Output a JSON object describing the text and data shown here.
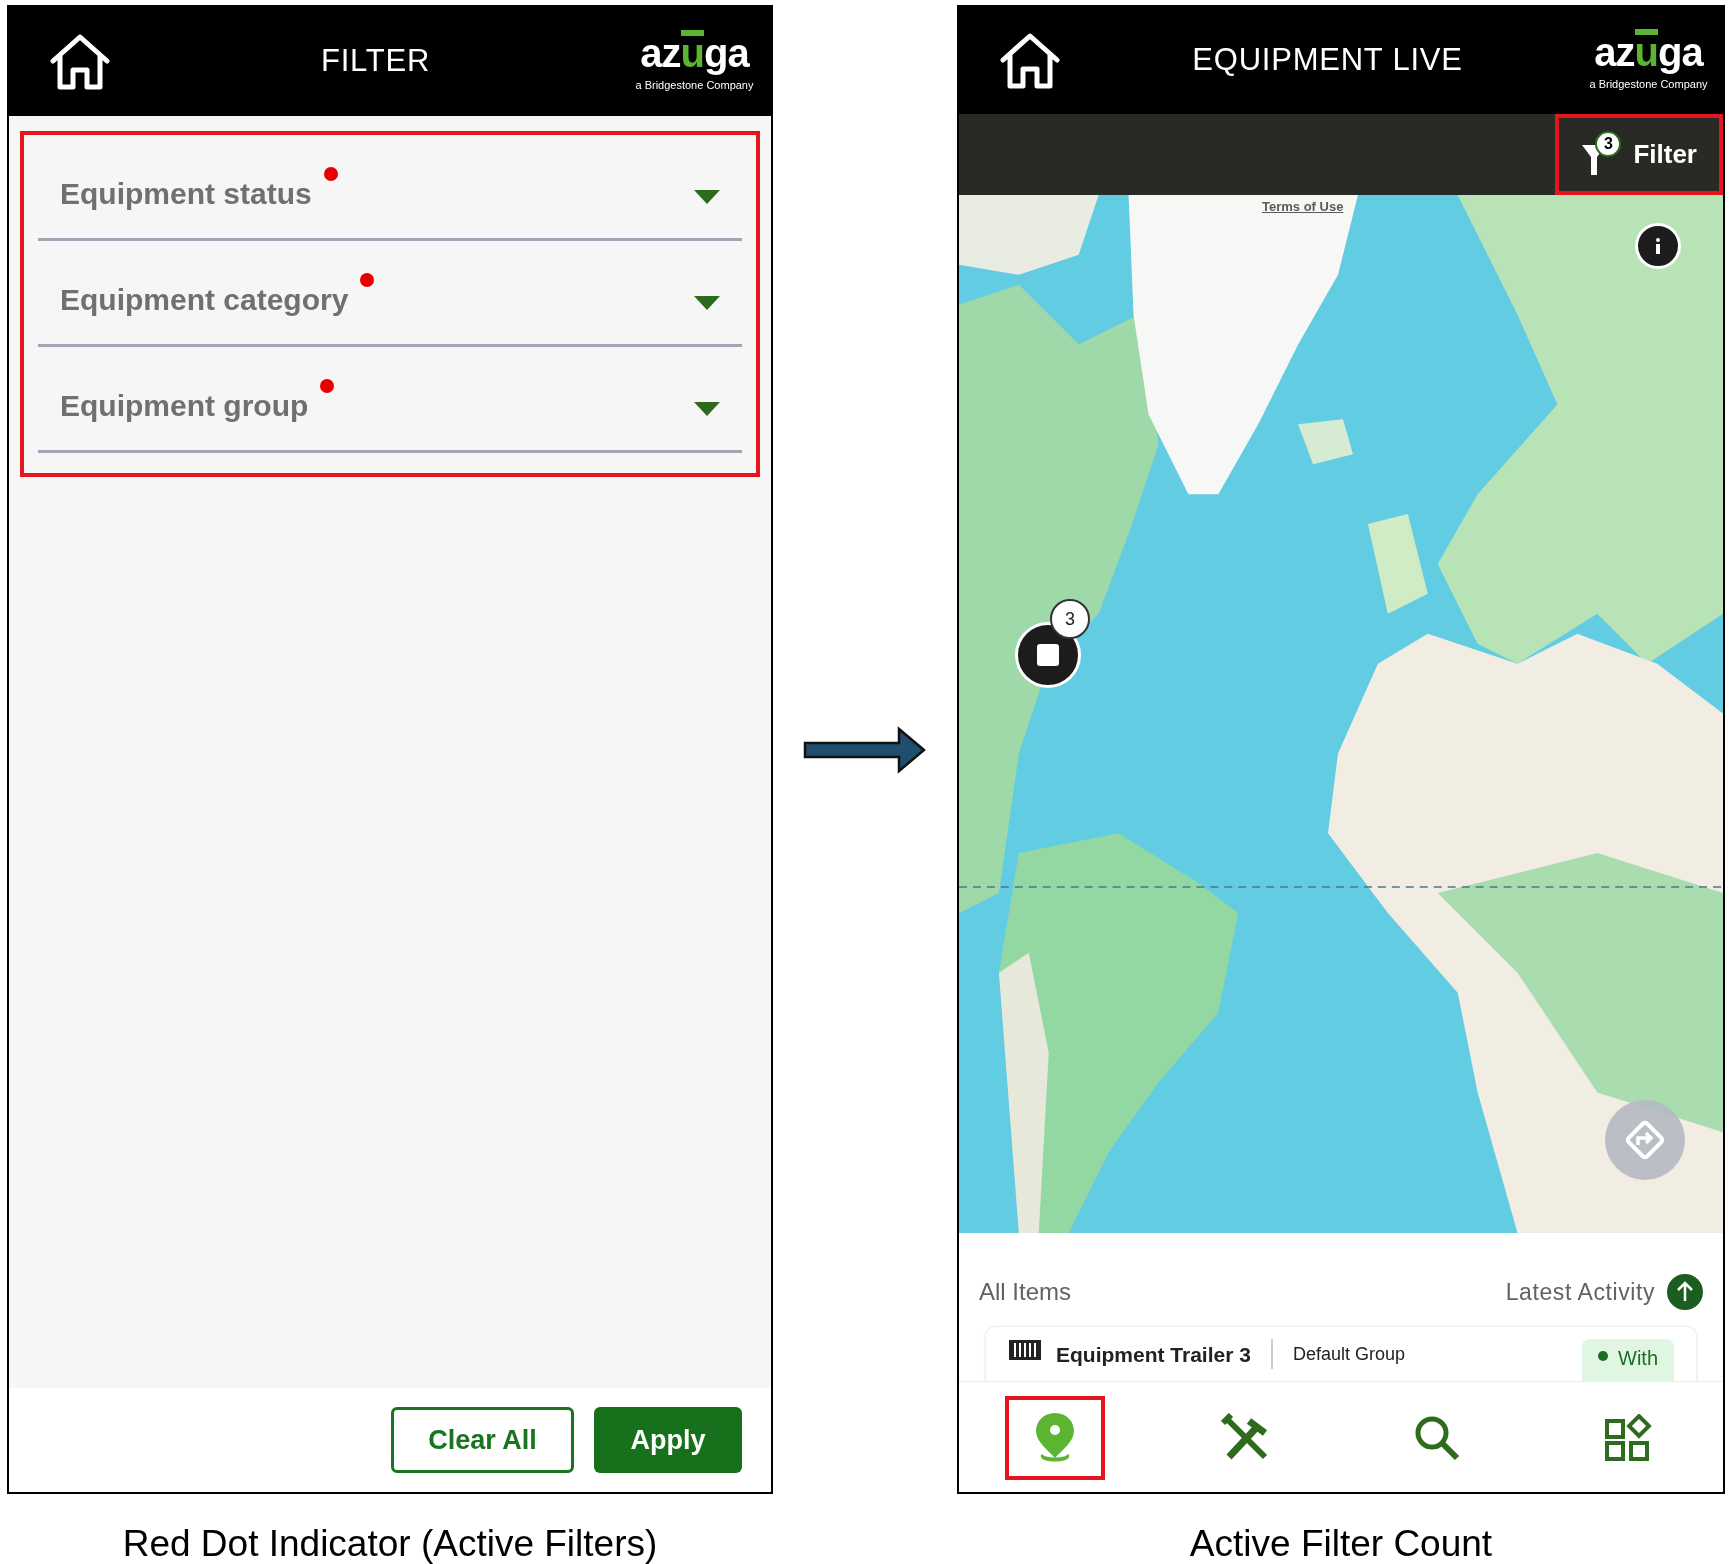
{
  "filter_screen": {
    "header": {
      "title": "FILTER",
      "logo": {
        "start": "az",
        "accent": "u",
        "end": "ga",
        "tagline": "a Bridgestone Company"
      }
    },
    "fields_annotated": true,
    "fields": [
      {
        "label": "Equipment status",
        "active": true
      },
      {
        "label": "Equipment category",
        "active": true
      },
      {
        "label": "Equipment group",
        "active": true
      }
    ],
    "buttons": [
      {
        "label": "Clear All",
        "kind": "outline"
      },
      {
        "label": "Apply",
        "kind": "filled"
      }
    ]
  },
  "live_screen": {
    "header": {
      "title": "EQUIPMENT LIVE",
      "logo": {
        "start": "az",
        "accent": "u",
        "end": "ga",
        "tagline": "a Bridgestone Company"
      }
    },
    "filter_button": {
      "label": "Filter",
      "count": "3",
      "annotated": true
    },
    "map": {
      "terms_link": "Terms of Use",
      "cluster_count": "3"
    },
    "sheet": {
      "title": "All Items",
      "sort_label": "Latest Activity",
      "items": [
        {
          "name": "Equipment Trailer 3",
          "group": "Default Group",
          "status": "With"
        }
      ]
    },
    "nav": [
      {
        "kind": "map",
        "selected": true,
        "annotated": true
      },
      {
        "kind": "tools",
        "selected": false,
        "annotated": false
      },
      {
        "kind": "search",
        "selected": false,
        "annotated": false
      },
      {
        "kind": "apps",
        "selected": false,
        "annotated": false
      }
    ]
  },
  "captions": [
    "Red Dot Indicator (Active Filters)",
    "Active Filter Count"
  ]
}
